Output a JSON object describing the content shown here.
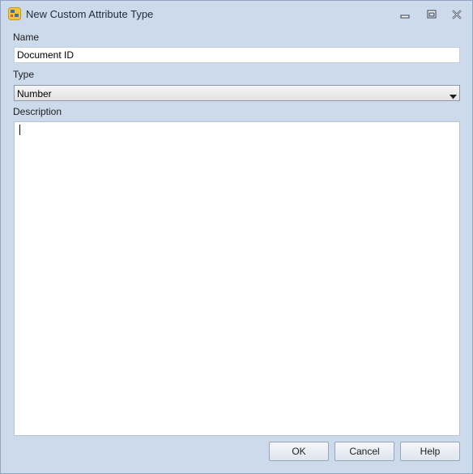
{
  "window": {
    "title": "New Custom Attribute Type",
    "icon": "custom-attribute-app-icon",
    "controls": [
      "minimize-icon",
      "maximize-icon",
      "close-icon"
    ]
  },
  "form": {
    "name_label": "Name",
    "name_value": "Document ID",
    "type_label": "Type",
    "type_value": "Number",
    "description_label": "Description",
    "description_value": ""
  },
  "buttons": {
    "ok": "OK",
    "cancel": "Cancel",
    "help": "Help"
  }
}
